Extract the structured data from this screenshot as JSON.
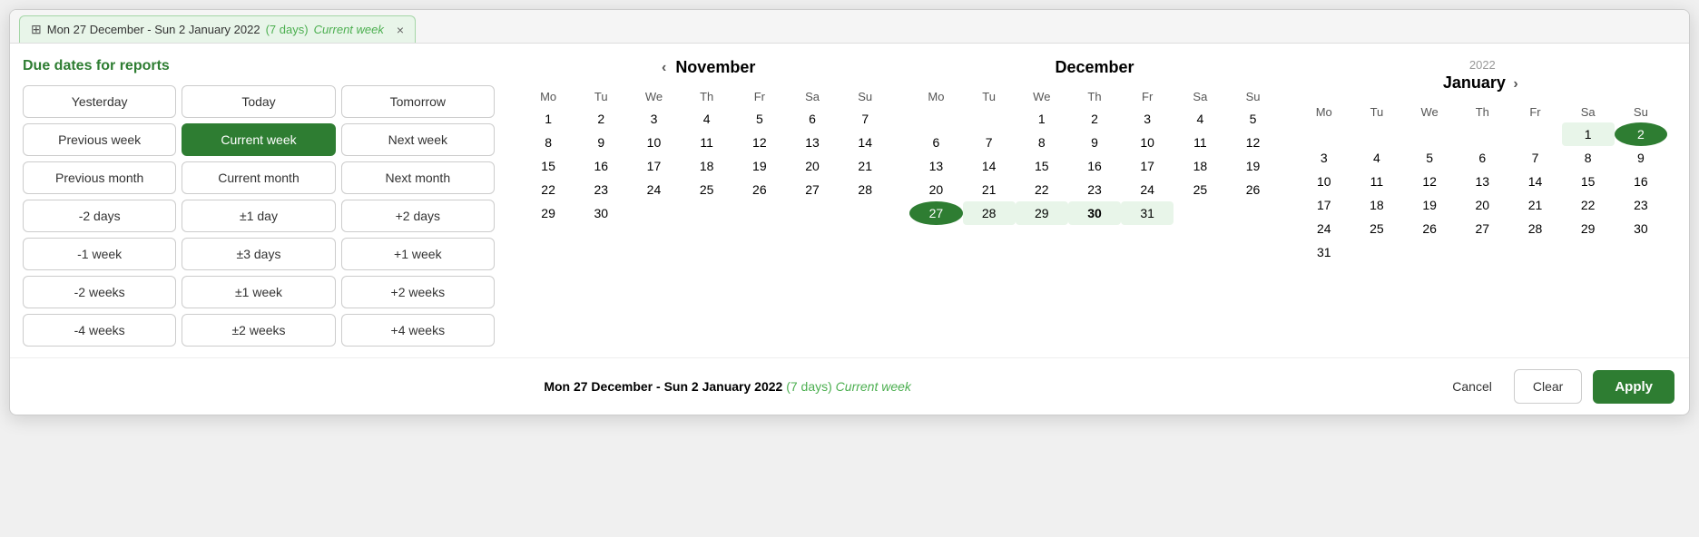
{
  "tab": {
    "icon": "⊞",
    "text": "Mon 27 December - Sun 2 January 2022",
    "days": "(7 days)",
    "week": "Current week",
    "close": "×"
  },
  "leftPanel": {
    "title": "Due dates for reports",
    "buttons": [
      [
        "Yesterday",
        "Today",
        "Tomorrow"
      ],
      [
        "Previous week",
        "Current week",
        "Next week"
      ],
      [
        "Previous month",
        "Current month",
        "Next month"
      ],
      [
        "-2 days",
        "±1 day",
        "+2 days"
      ],
      [
        "-1 week",
        "±3 days",
        "+1 week"
      ],
      [
        "-2 weeks",
        "±1 week",
        "+2 weeks"
      ],
      [
        "-4 weeks",
        "±2 weeks",
        "+4 weeks"
      ]
    ],
    "active": "Current week"
  },
  "november": {
    "nav_prev": "‹",
    "title": "November",
    "year": "",
    "days_of_week": [
      "Mo",
      "Tu",
      "We",
      "Th",
      "Fr",
      "Sa",
      "Su"
    ],
    "weeks": [
      [
        {
          "d": "1"
        },
        {
          "d": "2"
        },
        {
          "d": "3"
        },
        {
          "d": "4"
        },
        {
          "d": "5"
        },
        {
          "d": "6"
        },
        {
          "d": "7"
        }
      ],
      [
        {
          "d": "8"
        },
        {
          "d": "9"
        },
        {
          "d": "10"
        },
        {
          "d": "11"
        },
        {
          "d": "12"
        },
        {
          "d": "13"
        },
        {
          "d": "14"
        }
      ],
      [
        {
          "d": "15"
        },
        {
          "d": "16"
        },
        {
          "d": "17"
        },
        {
          "d": "18"
        },
        {
          "d": "19"
        },
        {
          "d": "20"
        },
        {
          "d": "21"
        }
      ],
      [
        {
          "d": "22"
        },
        {
          "d": "23"
        },
        {
          "d": "24"
        },
        {
          "d": "25"
        },
        {
          "d": "26"
        },
        {
          "d": "27"
        },
        {
          "d": "28"
        }
      ],
      [
        {
          "d": "29"
        },
        {
          "d": "30"
        },
        {
          "d": ""
        },
        {
          "d": ""
        },
        {
          "d": ""
        },
        {
          "d": ""
        },
        {
          "d": ""
        }
      ]
    ]
  },
  "december": {
    "title": "December",
    "year": "",
    "days_of_week": [
      "Mo",
      "Tu",
      "We",
      "Th",
      "Fr",
      "Sa",
      "Su"
    ],
    "weeks": [
      [
        {
          "d": ""
        },
        {
          "d": ""
        },
        {
          "d": "1"
        },
        {
          "d": "2"
        },
        {
          "d": "3"
        },
        {
          "d": "4"
        },
        {
          "d": "5"
        }
      ],
      [
        {
          "d": "6"
        },
        {
          "d": "7"
        },
        {
          "d": "8"
        },
        {
          "d": "9"
        },
        {
          "d": "10"
        },
        {
          "d": "11"
        },
        {
          "d": "12"
        }
      ],
      [
        {
          "d": "13"
        },
        {
          "d": "14"
        },
        {
          "d": "15"
        },
        {
          "d": "16"
        },
        {
          "d": "17"
        },
        {
          "d": "18"
        },
        {
          "d": "19"
        }
      ],
      [
        {
          "d": "20"
        },
        {
          "d": "21"
        },
        {
          "d": "22"
        },
        {
          "d": "23"
        },
        {
          "d": "24"
        },
        {
          "d": "25"
        },
        {
          "d": "26"
        }
      ],
      [
        {
          "d": "27",
          "sel": "start"
        },
        {
          "d": "28",
          "range": true
        },
        {
          "d": "29",
          "range": true
        },
        {
          "d": "30",
          "bold": true,
          "range": true
        },
        {
          "d": "31",
          "range": true
        },
        {
          "d": ""
        },
        {
          "d": ""
        }
      ]
    ]
  },
  "january": {
    "title": "January",
    "year": "2022",
    "nav_next": "›",
    "days_of_week": [
      "Mo",
      "Tu",
      "We",
      "Th",
      "Fr",
      "Sa",
      "Su"
    ],
    "weeks": [
      [
        {
          "d": ""
        },
        {
          "d": ""
        },
        {
          "d": ""
        },
        {
          "d": ""
        },
        {
          "d": ""
        },
        {
          "d": "1",
          "range": true
        },
        {
          "d": "2",
          "sel": "end"
        }
      ],
      [
        {
          "d": "3"
        },
        {
          "d": "4"
        },
        {
          "d": "5"
        },
        {
          "d": "6"
        },
        {
          "d": "7"
        },
        {
          "d": "8"
        },
        {
          "d": "9"
        }
      ],
      [
        {
          "d": "10"
        },
        {
          "d": "11"
        },
        {
          "d": "12"
        },
        {
          "d": "13"
        },
        {
          "d": "14"
        },
        {
          "d": "15"
        },
        {
          "d": "16"
        }
      ],
      [
        {
          "d": "17"
        },
        {
          "d": "18"
        },
        {
          "d": "19"
        },
        {
          "d": "20"
        },
        {
          "d": "21"
        },
        {
          "d": "22"
        },
        {
          "d": "23"
        }
      ],
      [
        {
          "d": "24"
        },
        {
          "d": "25"
        },
        {
          "d": "26"
        },
        {
          "d": "27"
        },
        {
          "d": "28"
        },
        {
          "d": "29"
        },
        {
          "d": "30"
        }
      ],
      [
        {
          "d": "31"
        },
        {
          "d": ""
        },
        {
          "d": ""
        },
        {
          "d": ""
        },
        {
          "d": ""
        },
        {
          "d": ""
        },
        {
          "d": ""
        }
      ]
    ]
  },
  "footer": {
    "range_text": "Mon 27 December - Sun 2 January 2022",
    "days": "(7 days)",
    "week": "Current week",
    "cancel_label": "Cancel",
    "clear_label": "Clear",
    "apply_label": "Apply"
  }
}
